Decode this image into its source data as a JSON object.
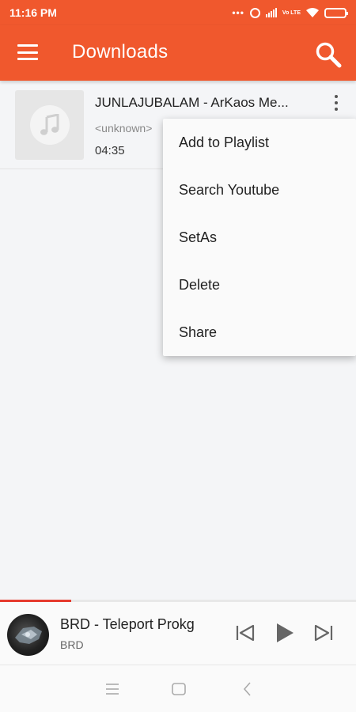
{
  "status_bar": {
    "time": "11:16 PM",
    "volte": "Vo LTE"
  },
  "header": {
    "title": "Downloads"
  },
  "songs": [
    {
      "title": "JUNLAJUBALAM - ArKaos Me...",
      "artist": "<unknown>",
      "duration": "04:35"
    }
  ],
  "context_menu": {
    "items": [
      {
        "label": "Add to Playlist"
      },
      {
        "label": "Search Youtube"
      },
      {
        "label": "SetAs"
      },
      {
        "label": "Delete"
      },
      {
        "label": "Share"
      }
    ]
  },
  "now_playing": {
    "title": "BRD - Teleport Prokg",
    "artist": "BRD",
    "progress_fraction": 0.2
  },
  "colors": {
    "accent": "#f0582d",
    "progress": "#e63b2e"
  },
  "icons": {
    "menu": "hamburger-icon",
    "search": "search-icon",
    "more": "more-vert-icon",
    "music": "music-note-icon",
    "prev": "skip-previous-icon",
    "play": "play-icon",
    "next": "skip-next-icon"
  }
}
